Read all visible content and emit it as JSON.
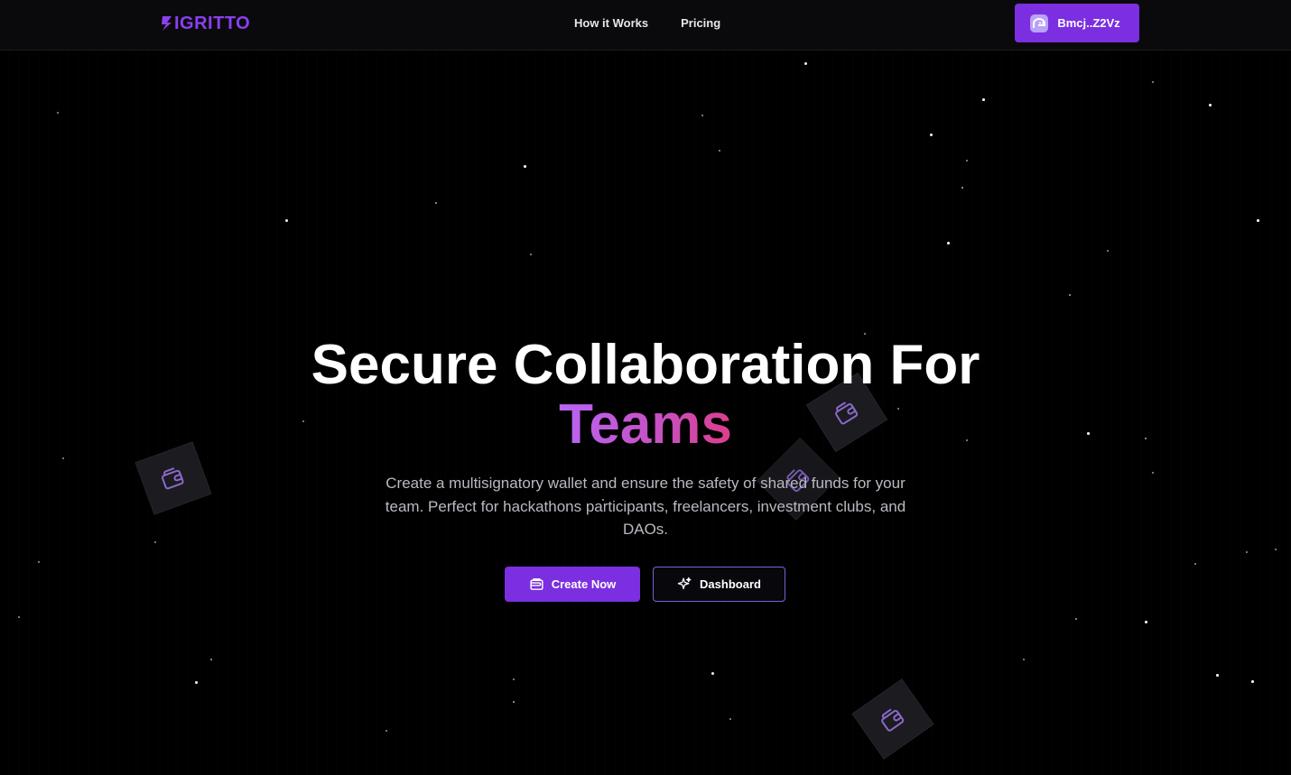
{
  "header": {
    "logo_text": "IGRITTO",
    "nav": [
      {
        "label": "How it Works"
      },
      {
        "label": "Pricing"
      }
    ],
    "wallet_address": "Bmcj..Z2Vz"
  },
  "hero": {
    "title_line1": "Secure Collaboration For",
    "title_line2": "Teams",
    "subtitle": "Create a multisignatory wallet and ensure the safety of shared funds for your team. Perfect for hackathons participants, freelancers, investment clubs, and DAOs.",
    "primary_button": "Create Now",
    "secondary_button": "Dashboard"
  },
  "colors": {
    "accent": "#7b2fe0",
    "gradient_start": "#b865f4",
    "gradient_end": "#dc3e8a",
    "background": "#000000"
  },
  "icons": {
    "wallet_icon": "wallet-icon",
    "sparkles_icon": "sparkles-icon",
    "phantom_icon": "phantom-ghost-icon"
  }
}
